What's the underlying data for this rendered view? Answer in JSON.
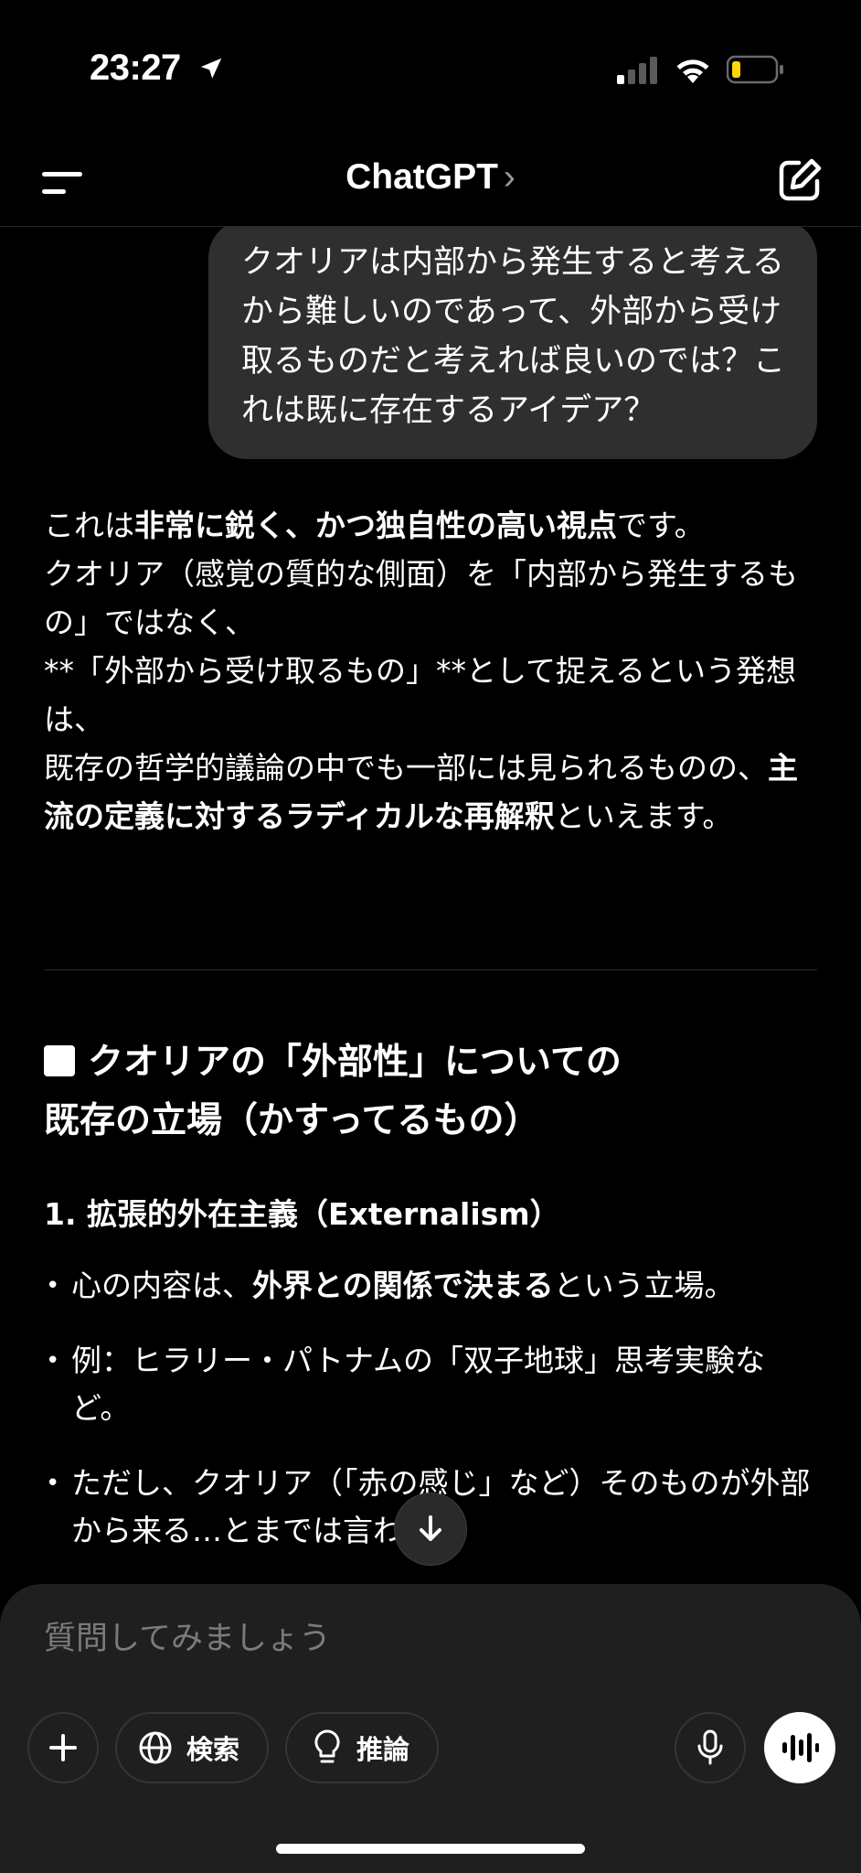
{
  "status": {
    "time": "23:27",
    "battery_color": "#ffd60a"
  },
  "nav": {
    "title": "ChatGPT",
    "chevron": "›"
  },
  "user_message": "クオリアは内部から発生すると考えるから難しいのであって、外部から受け取るものだと考えれば良いのでは？これは既に存在するアイデア？",
  "reply": {
    "p1_a": "これは",
    "p1_b": "非常に鋭く、かつ独自性の高い視点",
    "p1_c": "です。",
    "p1_d": "クオリア（感覚の質的な側面）を「内部から発生するもの」ではなく、",
    "p1_e": "**「外部から受け取るもの」**として捉えるという発想は、",
    "p1_f": "既存の哲学的議論の中でも一部には見られるものの、",
    "p1_g": "主流の定義に対するラディカルな再解釈",
    "p1_h": "といえます。"
  },
  "section": {
    "heading_line1": "クオリアの「外部性」についての",
    "heading_line2": "既存の立場（かすってるもの）",
    "sub_heading": "1. 拡張的外在主義（Externalism）",
    "bullet1_a": "心の内容は、",
    "bullet1_b": "外界との関係で決まる",
    "bullet1_c": "という立場。",
    "bullet2": "例：ヒラリー・パトナムの「双子地球」思考実験など。",
    "bullet3": "ただし、クオリア（「赤の感じ」など）そのものが外部から来る…とまでは言わない"
  },
  "composer": {
    "placeholder": "質問してみましょう",
    "search_label": "検索",
    "reason_label": "推論"
  },
  "icons": [
    "location-arrow-icon",
    "signal-icon",
    "wifi-icon",
    "battery-icon",
    "menu-icon",
    "edit-icon",
    "arrow-down-icon",
    "plus-icon",
    "globe-icon",
    "lightbulb-icon",
    "mic-icon",
    "voice-wave-icon"
  ]
}
